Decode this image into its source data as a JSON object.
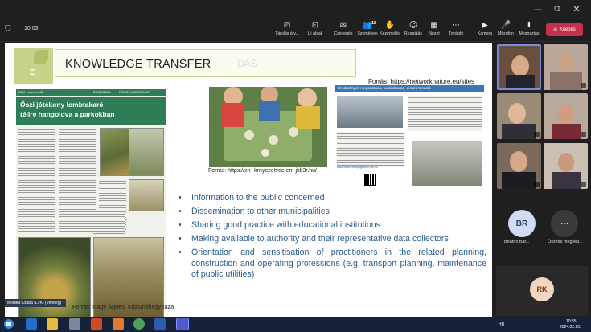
{
  "window": {
    "minimize_glyph": "—",
    "restore_glyph": "⧉",
    "close_glyph": "✕"
  },
  "meeting": {
    "timer": "10:03",
    "tools": [
      {
        "icon": "share-screen-icon",
        "glyph": "⎚",
        "label": "Tárolás átv..."
      },
      {
        "icon": "new-view-icon",
        "glyph": "⊡",
        "label": "Új ablak"
      },
      {
        "icon": "chat-icon",
        "glyph": "✉",
        "label": "Csevegés"
      },
      {
        "icon": "people-icon",
        "glyph": "👥",
        "label": "Személyek"
      },
      {
        "icon": "raise-hand-icon",
        "glyph": "✋",
        "label": "Kézemelés"
      },
      {
        "icon": "reactions-icon",
        "glyph": "☺",
        "label": "Reagálás"
      },
      {
        "icon": "view-icon",
        "glyph": "▦",
        "label": "Nézet"
      },
      {
        "icon": "more-icon",
        "glyph": "⋯",
        "label": "További"
      },
      {
        "icon": "camera-icon",
        "glyph": "▶",
        "label": "Kamera"
      },
      {
        "icon": "mic-off-icon",
        "glyph": "🎤",
        "label": "Mikrofon"
      },
      {
        "icon": "share-icon",
        "glyph": "⬆",
        "label": "Megosztás"
      }
    ],
    "people_count": "18",
    "leave_label": "Kilépés",
    "leave_glyph": "✆"
  },
  "slide": {
    "logo_letter": "E",
    "title": "KNOWLEDGE TRANSFER",
    "ghost_text": "DÁS",
    "source_top": "Forrás: https://networknature.eu/sites",
    "newspaper": {
      "header_left": "2024. november 18.",
      "header_mid": "ZÖLD OLDAL",
      "header_right": "FÉLEGYHÁZI KÖZLÖNY",
      "headline_1": "Őszi jótékony lombtakaró –",
      "headline_2": "télire hangoldva a parkokban",
      "credit": "Mónika Csaba (LTK) (Vendég)"
    },
    "source_news": "Forrás: Nagy Ágnes, Kiskunfélegyháza",
    "source_photo": "Forrás: https://xn--krnyezetvdelem-jkb3r.hu/",
    "web": {
      "header": "Eredmények megosztása, tudásátadás, disszemináció",
      "link": "www.oltarkertekpagtalbok.lxm.hu"
    },
    "bullets": [
      "Information to the public concerned",
      "Dissemination to other municipalities",
      "Sharing good practice with educational institutions",
      "Making available to authority and their representative data collectors",
      "Orientation and sensitisation of practitioners in the related planning, construction and operating professions (e.g. transport planning, maintenance of public utilities)"
    ],
    "bullet_glyph": "•"
  },
  "participants": {
    "br_initials": "BR",
    "br_name": "Beatrix Bar...",
    "more_label": "Összes megteki...",
    "more_glyph": "⋯",
    "rk_initials": "RK"
  },
  "taskbar": {
    "lang": "HU",
    "time": "10:55",
    "date": "2024.02.20."
  }
}
